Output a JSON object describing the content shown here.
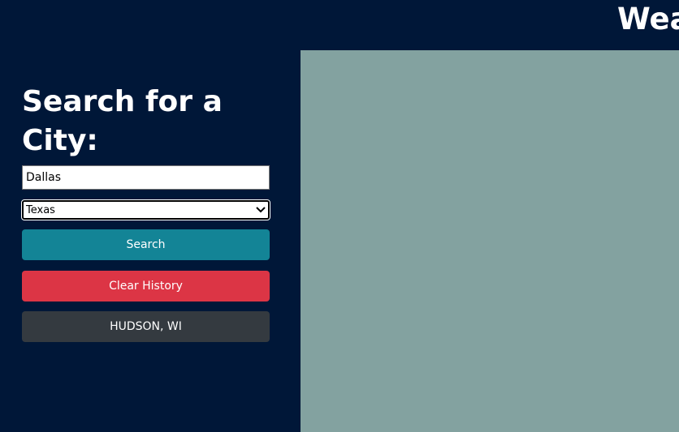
{
  "header": {
    "title": "Weather Dashboard"
  },
  "sidebar": {
    "heading": "Search for a City:",
    "city_input": {
      "value": "Dallas"
    },
    "state_select": {
      "selected": "Texas"
    },
    "search_button": "Search",
    "clear_button": "Clear History",
    "history": [
      "HUDSON, WI"
    ]
  },
  "colors": {
    "background": "#001738",
    "main_panel": "#83a2a0",
    "search_button": "#138496",
    "clear_button": "#dc3545",
    "history_button": "#343a40"
  }
}
